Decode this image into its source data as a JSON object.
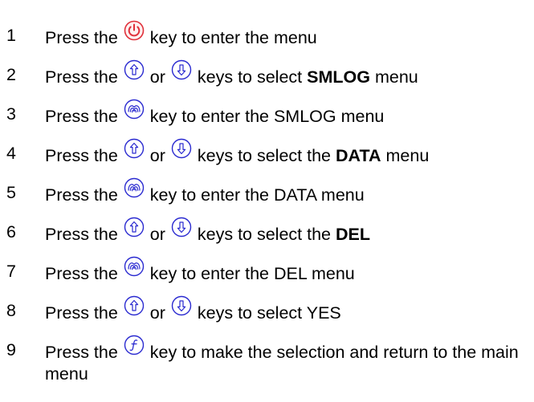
{
  "colors": {
    "power_key": "#e0303a",
    "nav_key": "#2a2ad0",
    "text": "#000000"
  },
  "icons": {
    "power": "power-key-icon",
    "up": "up-arrow-key-icon",
    "down": "down-arrow-key-icon",
    "enter": "enter-key-icon",
    "function": "function-key-icon"
  },
  "steps": [
    {
      "num": "1",
      "a": "Press the",
      "b": "key to enter the menu"
    },
    {
      "num": "2",
      "a": "Press the",
      "or": "or",
      "b": "keys to select",
      "bold": "SMLOG",
      "c": "menu"
    },
    {
      "num": "3",
      "a": "Press the",
      "b": "key to enter the SMLOG menu"
    },
    {
      "num": "4",
      "a": "Press the",
      "or": "or",
      "b": "keys to select the",
      "bold": "DATA",
      "c": "menu"
    },
    {
      "num": "5",
      "a": "Press the",
      "b": "key to enter the DATA menu"
    },
    {
      "num": "6",
      "a": "Press the",
      "or": "or",
      "b": "keys to select the",
      "bold": "DEL"
    },
    {
      "num": "7",
      "a": "Press the",
      "b": "key to enter the DEL menu"
    },
    {
      "num": "8",
      "a": "Press the",
      "or": "or",
      "b": "keys to select YES"
    },
    {
      "num": "9",
      "a": "Press the",
      "b": "key to make the selection and return to the main menu"
    }
  ]
}
